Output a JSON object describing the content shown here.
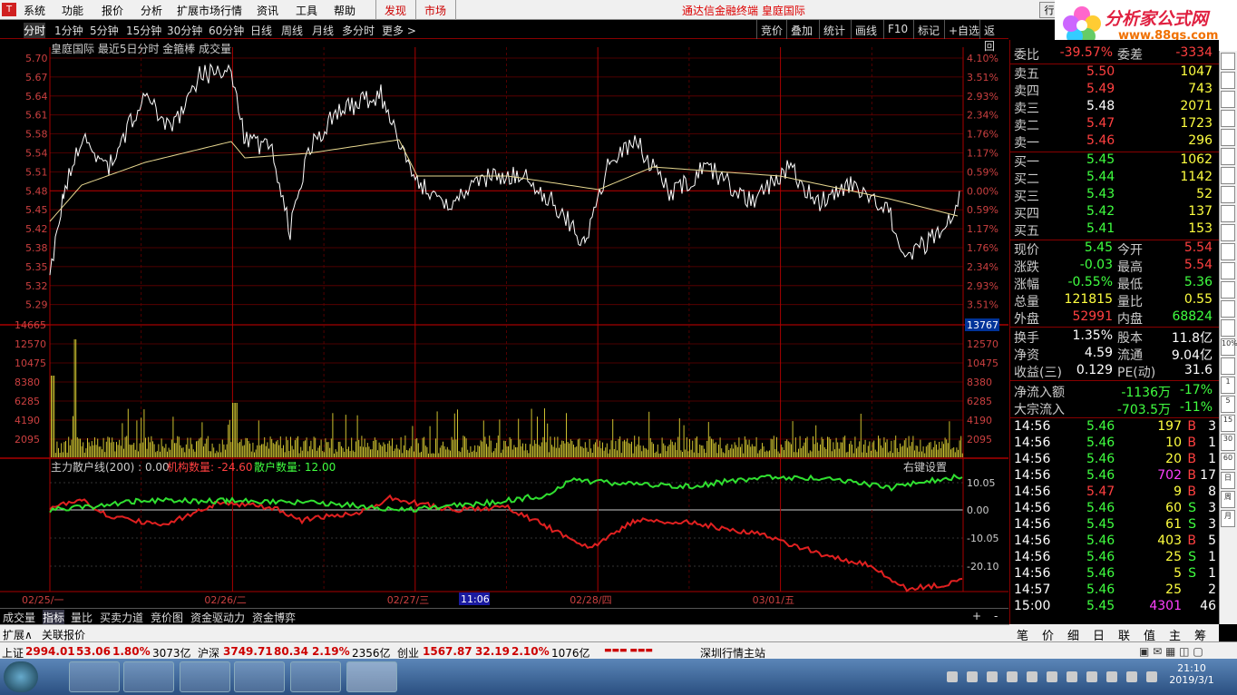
{
  "menu": {
    "items": [
      "系统",
      "功能",
      "报价",
      "分析",
      "扩展市场行情",
      "资讯",
      "工具",
      "帮助"
    ],
    "hot": [
      "发现",
      "市场"
    ],
    "notice": "通达信金融终端 皇庭国际",
    "win": [
      "行"
    ]
  },
  "brand": {
    "title": "分析家公式网",
    "url": "www.88gs.com"
  },
  "toolbar": {
    "periods": [
      "分时",
      "1分钟",
      "5分钟",
      "15分钟",
      "30分钟",
      "60分钟",
      "日线",
      "周线",
      "月线",
      "多分时",
      "更多 >"
    ],
    "right": [
      "竞价",
      "叠加",
      "统计",
      "画线",
      "F10",
      "标记",
      "+自选",
      "返回"
    ]
  },
  "chart": {
    "header": "皇庭国际  最近5日分时 金箍棒 成交量",
    "price_labels": [
      "5.70",
      "5.67",
      "5.64",
      "5.61",
      "5.58",
      "5.54",
      "5.51",
      "5.48",
      "5.45",
      "5.42",
      "5.38",
      "5.35",
      "5.32",
      "5.29"
    ],
    "pct_labels": [
      "4.10%",
      "3.51%",
      "2.93%",
      "2.34%",
      "1.76%",
      "1.17%",
      "0.59%",
      "0.00%",
      "0.59%",
      "1.17%",
      "1.76%",
      "2.34%",
      "2.93%",
      "3.51%"
    ],
    "vol_labels": [
      "14665",
      "12570",
      "10475",
      "8380",
      "6285",
      "4190",
      "2095"
    ],
    "vol_right_top": "13767",
    "ind_header": "主力散户线(200) : 0.00",
    "ind_jg": "机构数量: -24.60",
    "ind_sh": "散户数量: 12.00",
    "ind_setting": "右键设置",
    "ind_labels": [
      "10.05",
      "0.00",
      "-10.05",
      "-20.10"
    ],
    "dates": [
      "02/25/一",
      "02/26/二",
      "02/27/三",
      "02/28/四",
      "03/01/五"
    ],
    "time_marker": "11:06"
  },
  "quote": {
    "code_mark": "L",
    "wb": {
      "label": "委比",
      "val": "-39.57%",
      "label2": "委差",
      "val2": "-3334"
    },
    "asks": [
      {
        "l": "卖五",
        "p": "5.50",
        "v": "1047"
      },
      {
        "l": "卖四",
        "p": "5.49",
        "v": "743"
      },
      {
        "l": "卖三",
        "p": "5.48",
        "v": "2071"
      },
      {
        "l": "卖二",
        "p": "5.47",
        "v": "1723"
      },
      {
        "l": "卖一",
        "p": "5.46",
        "v": "296"
      }
    ],
    "bids": [
      {
        "l": "买一",
        "p": "5.45",
        "v": "1062"
      },
      {
        "l": "买二",
        "p": "5.44",
        "v": "1142"
      },
      {
        "l": "买三",
        "p": "5.43",
        "v": "52"
      },
      {
        "l": "买四",
        "p": "5.42",
        "v": "137"
      },
      {
        "l": "买五",
        "p": "5.41",
        "v": "153"
      }
    ],
    "stats": [
      [
        "现价",
        "5.45",
        "今开",
        "5.54"
      ],
      [
        "涨跌",
        "-0.03",
        "最高",
        "5.54"
      ],
      [
        "涨幅",
        "-0.55%",
        "最低",
        "5.36"
      ],
      [
        "总量",
        "121815",
        "量比",
        "0.55"
      ],
      [
        "外盘",
        "52991",
        "内盘",
        "68824"
      ],
      [
        "换手",
        "1.35%",
        "股本",
        "11.8亿"
      ],
      [
        "净资",
        "4.59",
        "流通",
        "9.04亿"
      ],
      [
        "收益(三)",
        "0.129",
        "PE(动)",
        "31.6"
      ]
    ],
    "flow": [
      [
        "净流入额",
        "-1136万",
        "-17%"
      ],
      [
        "大宗流入",
        "-703.5万",
        "-11%"
      ]
    ],
    "ticks": [
      [
        "14:56",
        "5.46",
        "197",
        "B",
        "3"
      ],
      [
        "14:56",
        "5.46",
        "10",
        "B",
        "1"
      ],
      [
        "14:56",
        "5.46",
        "20",
        "B",
        "1"
      ],
      [
        "14:56",
        "5.46",
        "702",
        "B",
        "17"
      ],
      [
        "14:56",
        "5.47",
        "9",
        "B",
        "8"
      ],
      [
        "14:56",
        "5.46",
        "60",
        "S",
        "3"
      ],
      [
        "14:56",
        "5.45",
        "61",
        "S",
        "3"
      ],
      [
        "14:56",
        "5.46",
        "403",
        "B",
        "5"
      ],
      [
        "14:56",
        "5.46",
        "25",
        "S",
        "1"
      ],
      [
        "14:56",
        "5.46",
        "5",
        "S",
        "1"
      ],
      [
        "14:57",
        "5.46",
        "25",
        "",
        "2"
      ],
      [
        "15:00",
        "5.45",
        "4301",
        "",
        "46"
      ]
    ]
  },
  "bottomtabs": [
    "成交量",
    "指标",
    "量比",
    "买卖力道",
    "竞价图",
    "资金驱动力",
    "资金博弈"
  ],
  "righttabs": [
    "笔",
    "价",
    "细",
    "日",
    "联",
    "值",
    "主",
    "筹"
  ],
  "expand": [
    "扩展∧",
    "关联报价"
  ],
  "status": {
    "sh_label": "上证",
    "sh": "2994.01",
    "sh_chg": "53.06",
    "sh_pct": "1.80%",
    "sh_amt": "3073亿",
    "hs_label": "沪深",
    "hs": "3749.71",
    "hs_chg": "80.34",
    "hs_pct": "2.19%",
    "hs_amt": "2356亿",
    "cy_label": "创业",
    "cy": "1567.87",
    "cy_chg": "32.19",
    "cy_pct": "2.10%",
    "cy_amt": "1076亿",
    "server": "深圳行情主站"
  },
  "clock": {
    "time": "21:10",
    "date": "2019/3/1"
  },
  "sidebar_icons": [
    "chart-icon",
    "list-icon",
    "grid-icon",
    "bars-icon",
    "line-icon",
    "kline-icon",
    "table-icon",
    "fx-icon",
    "fn-icon",
    "box-icon",
    "doc-icon",
    "ring-icon",
    "wave-icon",
    "multi-icon",
    "bar2-icon",
    "10%",
    "pen-icon",
    "1",
    "5",
    "15",
    "30",
    "60",
    "日",
    "周",
    "月"
  ]
}
